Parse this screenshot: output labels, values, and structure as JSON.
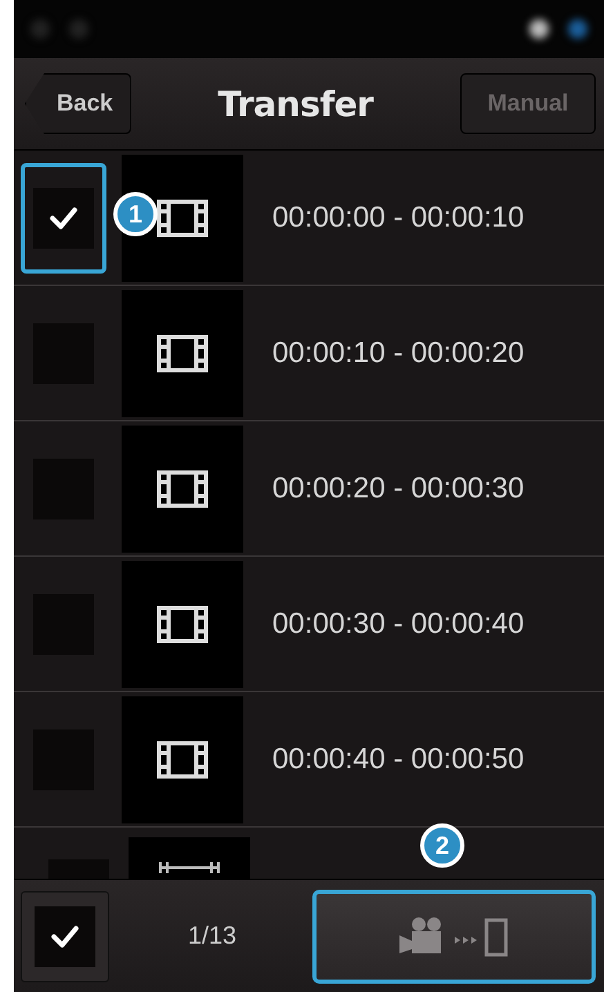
{
  "nav_bar": {
    "back_button": "Back",
    "title": "Transfer",
    "manual_button": {
      "label": "Manual",
      "disabled": true
    }
  },
  "rows": [
    {
      "checked": true,
      "highlighted": true,
      "callout": "1",
      "time": "00:00:00 - 00:00:10"
    },
    {
      "checked": false,
      "highlighted": false,
      "time": "00:00:10 - 00:00:20"
    },
    {
      "checked": false,
      "highlighted": false,
      "time": "00:00:20 - 00:00:30"
    },
    {
      "checked": false,
      "highlighted": false,
      "time": "00:00:30 - 00:00:40"
    },
    {
      "checked": false,
      "highlighted": false,
      "time": "00:00:40 - 00:00:50"
    }
  ],
  "partial_row": {
    "checked": false
  },
  "bottom_bar": {
    "select_all": {
      "checked": true
    },
    "count": "1/13",
    "transfer_button": {
      "highlighted": true,
      "callout": "2"
    }
  }
}
